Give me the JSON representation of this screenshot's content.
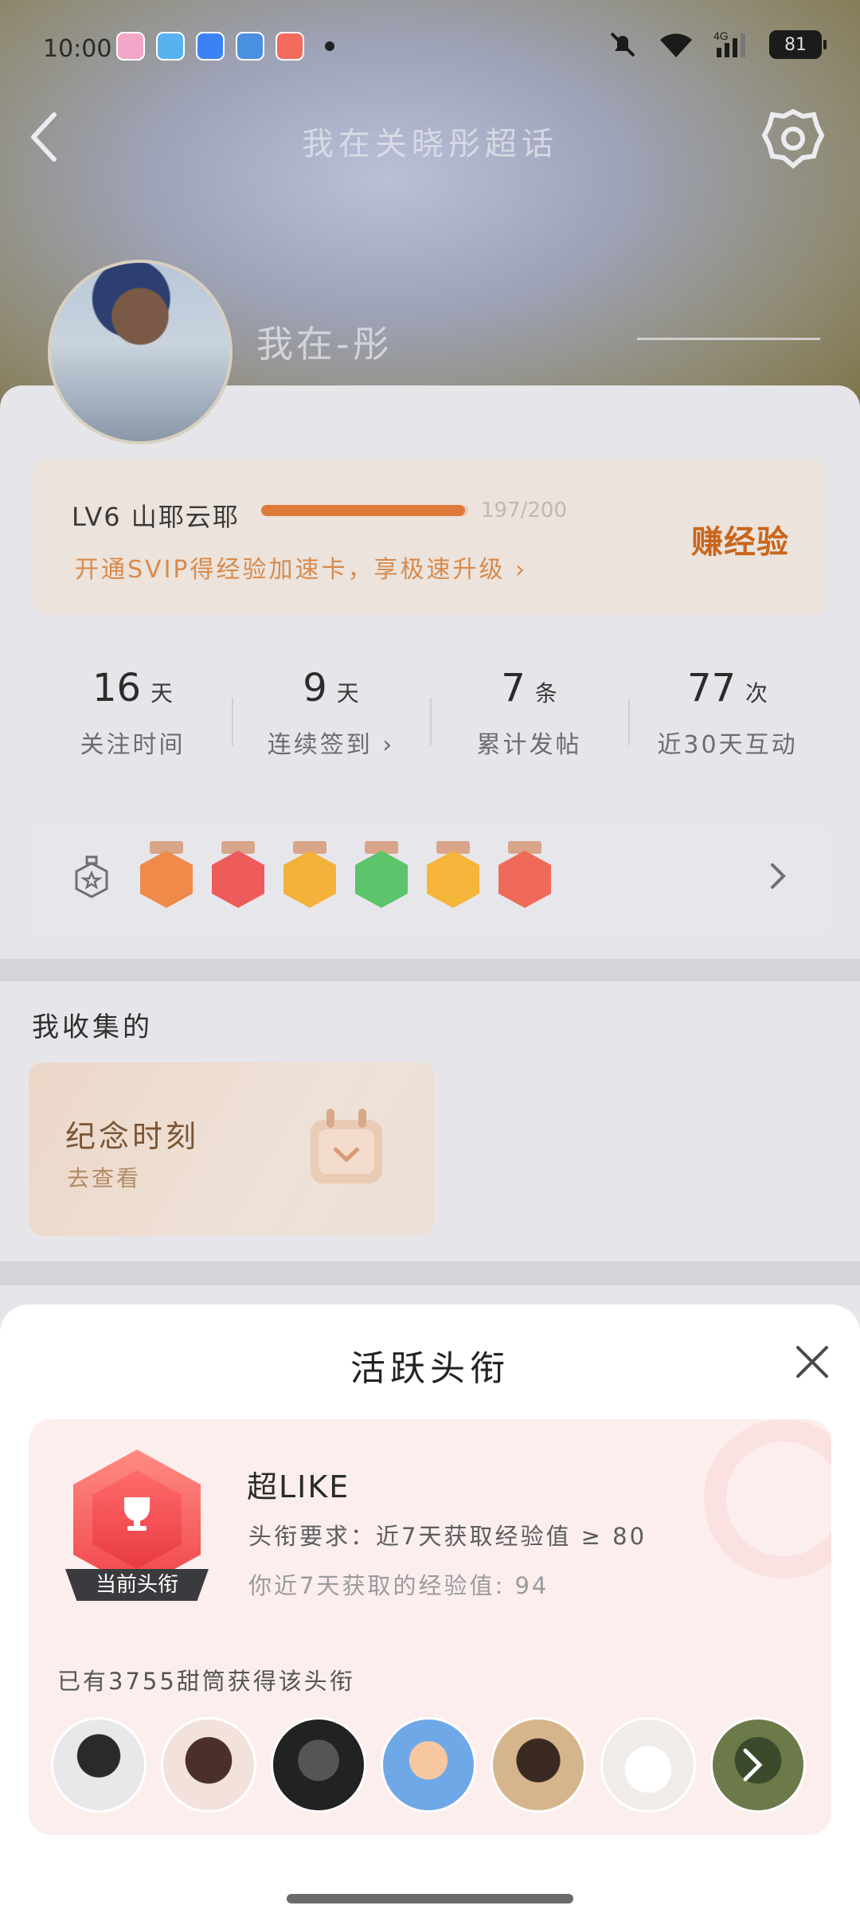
{
  "status_bar": {
    "time": "10:00",
    "battery": "81",
    "network": "4G"
  },
  "header": {
    "title": "我在关晓彤超话"
  },
  "profile": {
    "username": "我在-彤"
  },
  "level": {
    "name": "LV6 山耶云耶",
    "progress_text": "197/200",
    "progress_value": 197,
    "progress_max": 200,
    "svip_text": "开通SVIP得经验加速卡，享极速升级 ›",
    "earn_button": "赚经验"
  },
  "stats": [
    {
      "value": "16",
      "unit": "天",
      "label": "关注时间"
    },
    {
      "value": "9",
      "unit": "天",
      "label": "连续签到 ›"
    },
    {
      "value": "7",
      "unit": "条",
      "label": "累计发帖"
    },
    {
      "value": "77",
      "unit": "次",
      "label": "近30天互动"
    }
  ],
  "medals": [
    {
      "icon": "lve-medal-icon",
      "color": "#f08a4b"
    },
    {
      "icon": "trophy-medal-icon",
      "color": "#ee5b5b"
    },
    {
      "icon": "hi-medal-icon",
      "color": "#f4b23c"
    },
    {
      "icon": "hand-medal-icon",
      "color": "#5cc46a"
    },
    {
      "icon": "laugh-medal-icon",
      "color": "#f5b53a"
    },
    {
      "icon": "rock-hand-medal-icon",
      "color": "#f06a5a"
    }
  ],
  "collections": {
    "title": "我收集的",
    "card_title": "纪念时刻",
    "card_sub": "去查看"
  },
  "sheet": {
    "title": "活跃头衔",
    "badge_tag": "当前头衔",
    "rank_name": "超LIKE",
    "requirement": "头衔要求：近7天获取经验值 ≥ 80",
    "my_value": "你近7天获取的经验值: 94",
    "holders_text": "已有3755甜筒获得该头衔"
  },
  "colors": {
    "accent_orange": "#e07a3a",
    "earn_orange": "#c9661c",
    "sheet_card_bg": "#fdeeee"
  }
}
